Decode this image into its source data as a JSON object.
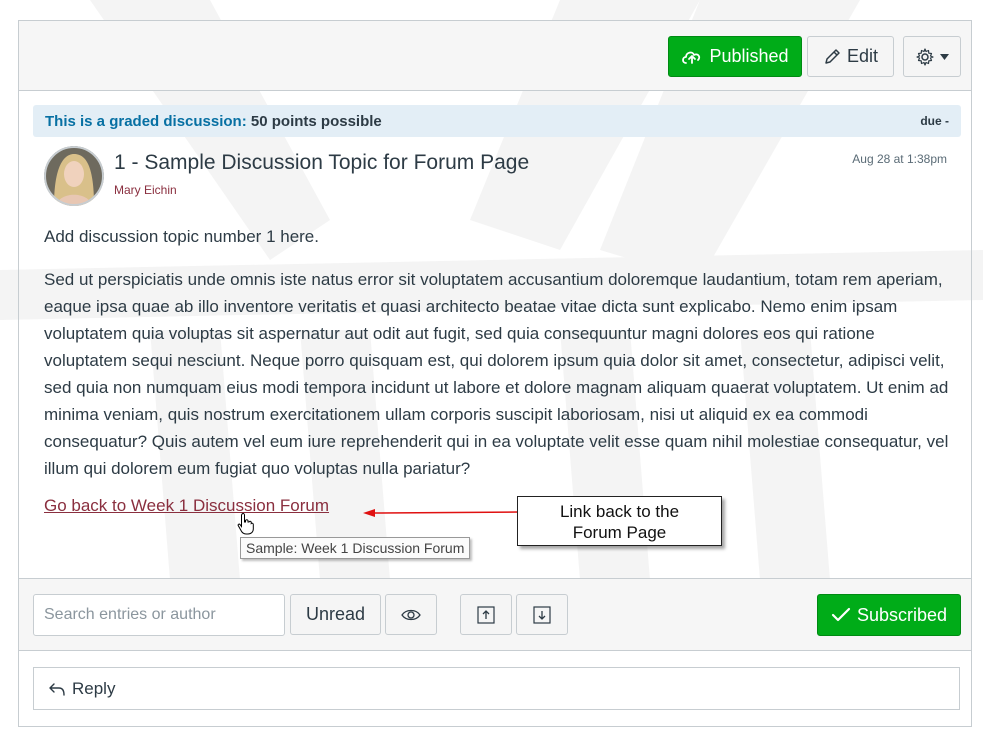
{
  "header": {
    "published_label": "Published",
    "edit_label": "Edit"
  },
  "banner": {
    "graded_label": "This is a graded discussion:",
    "points": "50 points possible",
    "due": "due -"
  },
  "topic": {
    "title": "1 - Sample Discussion Topic for Forum Page",
    "author": "Mary Eichin",
    "date": "Aug 28 at 1:38pm",
    "intro": "Add discussion topic number 1 here.",
    "body": "Sed ut perspiciatis unde omnis iste natus error sit voluptatem accusantium doloremque laudantium, totam rem aperiam, eaque ipsa quae ab illo inventore veritatis et quasi architecto beatae vitae dicta sunt explicabo. Nemo enim ipsam voluptatem quia voluptas sit aspernatur aut odit aut fugit, sed quia consequuntur magni dolores eos qui ratione voluptatem sequi nesciunt. Neque porro quisquam est, qui dolorem ipsum quia dolor sit amet, consectetur, adipisci velit, sed quia non numquam eius modi tempora incidunt ut labore et dolore magnam aliquam quaerat voluptatem. Ut enim ad minima veniam, quis nostrum exercitationem ullam corporis suscipit laboriosam, nisi ut aliquid ex ea commodi consequatur? Quis autem vel eum iure reprehenderit qui in ea voluptate velit esse quam nihil molestiae consequatur, vel illum qui dolorem eum fugiat quo voluptas nulla pariatur?",
    "back_link": "Go back to Week 1 Discussion Forum",
    "tooltip": "Sample: Week 1 Discussion Forum"
  },
  "annotation": {
    "line1": "Link back to the",
    "line2": "Forum Page"
  },
  "toolbar": {
    "search_placeholder": "Search entries or author",
    "unread_label": "Unread",
    "subscribed_label": "Subscribed"
  },
  "reply": {
    "label": "Reply"
  },
  "colors": {
    "green": "#00ac18",
    "link": "#8a2f3f",
    "banner_bg": "#e3eef6",
    "banner_text": "#0770a3"
  },
  "icons": [
    "cloud-upload-icon",
    "pencil-icon",
    "gear-icon",
    "caret-down-icon",
    "eye-icon",
    "collapse-icon",
    "expand-icon",
    "checkmark-icon",
    "reply-arrow-icon",
    "hand-cursor-icon"
  ]
}
